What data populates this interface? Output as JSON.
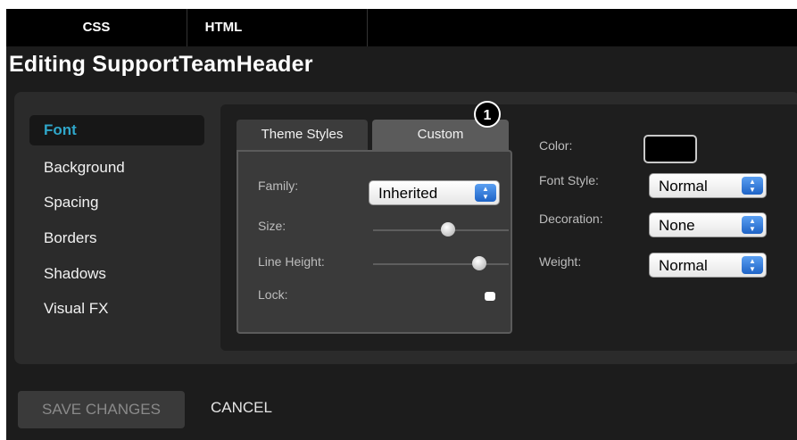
{
  "top_tabs": [
    "CSS",
    "HTML"
  ],
  "page_title": "Editing SupportTeamHeader",
  "sidebar": {
    "items": [
      {
        "label": "Font",
        "active": true
      },
      {
        "label": "Background"
      },
      {
        "label": "Spacing"
      },
      {
        "label": "Borders"
      },
      {
        "label": "Shadows"
      },
      {
        "label": "Visual FX"
      }
    ]
  },
  "editor_tabs": {
    "theme_label": "Theme Styles",
    "custom_label": "Custom",
    "badge": "1"
  },
  "custom": {
    "family_label": "Family:",
    "family_value": "Inherited",
    "size_label": "Size:",
    "size_level": 0.55,
    "line_height_label": "Line Height:",
    "line_height_level": 0.78,
    "lock_label": "Lock:"
  },
  "properties": {
    "color_label": "Color:",
    "color_value": "#000000",
    "font_style_label": "Font Style:",
    "font_style_value": "Normal",
    "decoration_label": "Decoration:",
    "decoration_value": "None",
    "weight_label": "Weight:",
    "weight_value": "Normal"
  },
  "footer": {
    "save_label": "SAVE CHANGES",
    "cancel_label": "CANCEL"
  },
  "colors": {
    "accent": "#2fa6c9",
    "stepper": "#2b78de"
  },
  "icons": [
    "up-down-stepper-icon"
  ]
}
